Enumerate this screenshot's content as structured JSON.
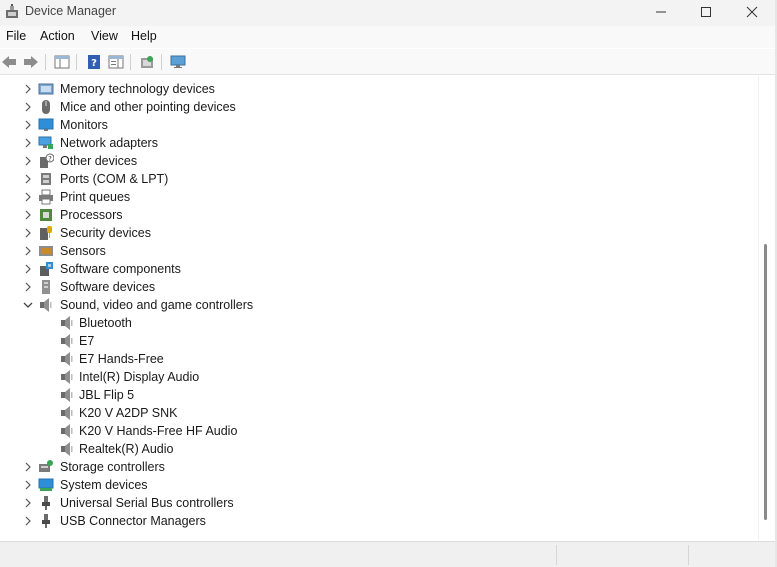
{
  "window": {
    "title": "Device Manager",
    "icon": "device-manager-icon",
    "controls": [
      "minimize-icon",
      "maximize-icon",
      "close-icon"
    ]
  },
  "menu": {
    "items": [
      "File",
      "Action",
      "View",
      "Help"
    ]
  },
  "toolbar": {
    "buttons": [
      "back-arrow-icon",
      "forward-arrow-icon",
      "properties-panel-icon",
      "help-icon",
      "console-tree-icon",
      "update-driver-icon",
      "scan-hardware-icon"
    ]
  },
  "tree": {
    "items": [
      {
        "label": "Memory technology devices",
        "icon": "memory-device-icon",
        "level": 0,
        "expanded": false
      },
      {
        "label": "Mice and other pointing devices",
        "icon": "mouse-icon",
        "level": 0,
        "expanded": false
      },
      {
        "label": "Monitors",
        "icon": "monitor-icon",
        "level": 0,
        "expanded": false
      },
      {
        "label": "Network adapters",
        "icon": "network-adapter-icon",
        "level": 0,
        "expanded": false
      },
      {
        "label": "Other devices",
        "icon": "unknown-device-icon",
        "level": 0,
        "expanded": false
      },
      {
        "label": "Ports (COM & LPT)",
        "icon": "port-icon",
        "level": 0,
        "expanded": false
      },
      {
        "label": "Print queues",
        "icon": "printer-icon",
        "level": 0,
        "expanded": false
      },
      {
        "label": "Processors",
        "icon": "processor-icon",
        "level": 0,
        "expanded": false
      },
      {
        "label": "Security devices",
        "icon": "security-device-icon",
        "level": 0,
        "expanded": false
      },
      {
        "label": "Sensors",
        "icon": "sensor-icon",
        "level": 0,
        "expanded": false
      },
      {
        "label": "Software components",
        "icon": "software-component-icon",
        "level": 0,
        "expanded": false
      },
      {
        "label": "Software devices",
        "icon": "software-device-icon",
        "level": 0,
        "expanded": false
      },
      {
        "label": "Sound, video and game controllers",
        "icon": "speaker-icon",
        "level": 0,
        "expanded": true
      },
      {
        "label": "Bluetooth",
        "icon": "speaker-icon",
        "level": 1
      },
      {
        "label": "E7",
        "icon": "speaker-icon",
        "level": 1
      },
      {
        "label": "E7 Hands-Free",
        "icon": "speaker-icon",
        "level": 1
      },
      {
        "label": "Intel(R) Display Audio",
        "icon": "speaker-icon",
        "level": 1
      },
      {
        "label": "JBL Flip 5",
        "icon": "speaker-icon",
        "level": 1
      },
      {
        "label": "K20 V A2DP SNK",
        "icon": "speaker-icon",
        "level": 1
      },
      {
        "label": "K20 V Hands-Free HF Audio",
        "icon": "speaker-icon",
        "level": 1
      },
      {
        "label": "Realtek(R) Audio",
        "icon": "speaker-icon",
        "level": 1
      },
      {
        "label": "Storage controllers",
        "icon": "storage-controller-icon",
        "level": 0,
        "expanded": false
      },
      {
        "label": "System devices",
        "icon": "system-device-icon",
        "level": 0,
        "expanded": false
      },
      {
        "label": "Universal Serial Bus controllers",
        "icon": "usb-icon",
        "level": 0,
        "expanded": false
      },
      {
        "label": "USB Connector Managers",
        "icon": "usb-icon",
        "level": 0,
        "expanded": false
      }
    ]
  },
  "colors": {
    "titlebar": "#f3f3f3",
    "menubar": "#f9f9f9",
    "statusbar": "#f0f0f0",
    "scroll_thumb": "#8a8a8a"
  }
}
